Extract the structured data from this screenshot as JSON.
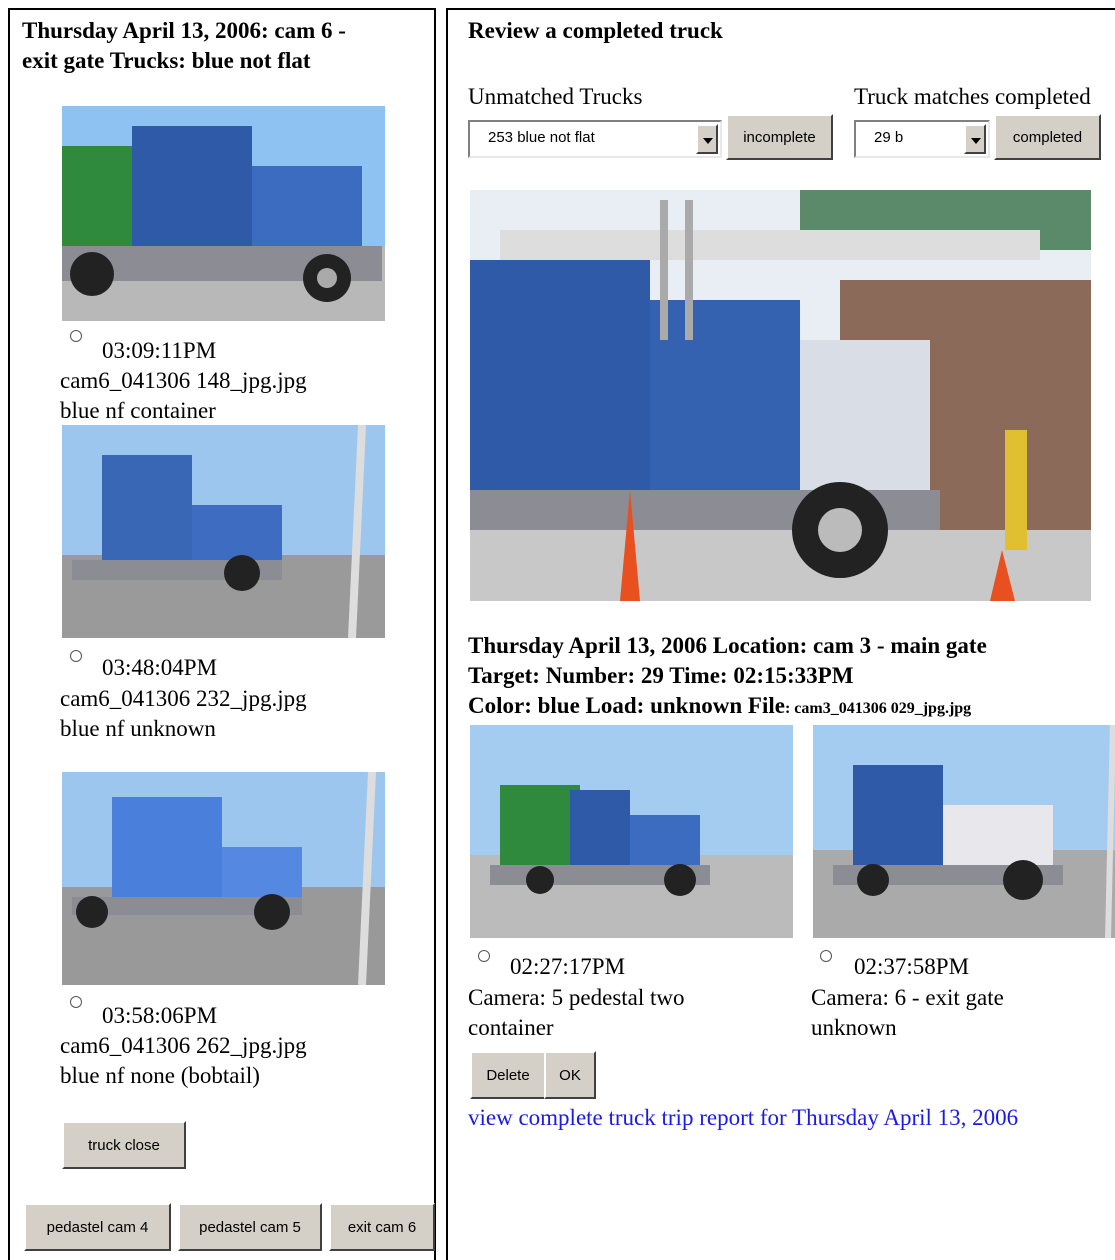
{
  "left": {
    "header_line1": "Thursday April 13, 2006:  cam 6 -",
    "header_line2": "exit gate Trucks:  blue   not flat",
    "trucks": [
      {
        "time": "03:09:11PM",
        "file": "cam6_041306 148_jpg.jpg",
        "desc": "blue  nf container"
      },
      {
        "time": "03:48:04PM",
        "file": "cam6_041306 232_jpg.jpg",
        "desc": "blue  nf unknown"
      },
      {
        "time": "03:58:06PM",
        "file": "cam6_041306 262_jpg.jpg",
        "desc": "blue  nf none (bobtail)"
      }
    ],
    "truck_close_label": "truck close",
    "bottom_buttons": [
      "pedastel cam 4",
      "pedastel cam 5",
      "exit cam 6"
    ]
  },
  "right": {
    "title": "Review a completed truck",
    "unmatched_label": "Unmatched Trucks",
    "unmatched_value": "253 blue not flat",
    "incomplete_label": "incomplete",
    "matches_label": "Truck matches completed",
    "matches_value": "29 b",
    "completed_label": "completed",
    "info_line1": "Thursday April 13, 2006   Location: cam 3 - main gate",
    "info_target": "Target: Number: 29   Time: 02:15:33PM",
    "info_color": "Color: blue   Load: unknown File",
    "info_file": ": cam3_041306 029_jpg.jpg",
    "matches": [
      {
        "time": "02:27:17PM",
        "camera": "Camera: 5 pedestal two",
        "load": "container"
      },
      {
        "time": "02:37:58PM",
        "camera": "Camera: 6  - exit gate",
        "load": "unknown"
      }
    ],
    "delete_label": "Delete",
    "ok_label": "OK",
    "report_link": "view complete  truck trip report for  Thursday April 13, 2006"
  },
  "colors": {
    "link": "#1a1ae6",
    "button_face": "#d4d0c8",
    "truck_blue": "#2e5aa8"
  }
}
